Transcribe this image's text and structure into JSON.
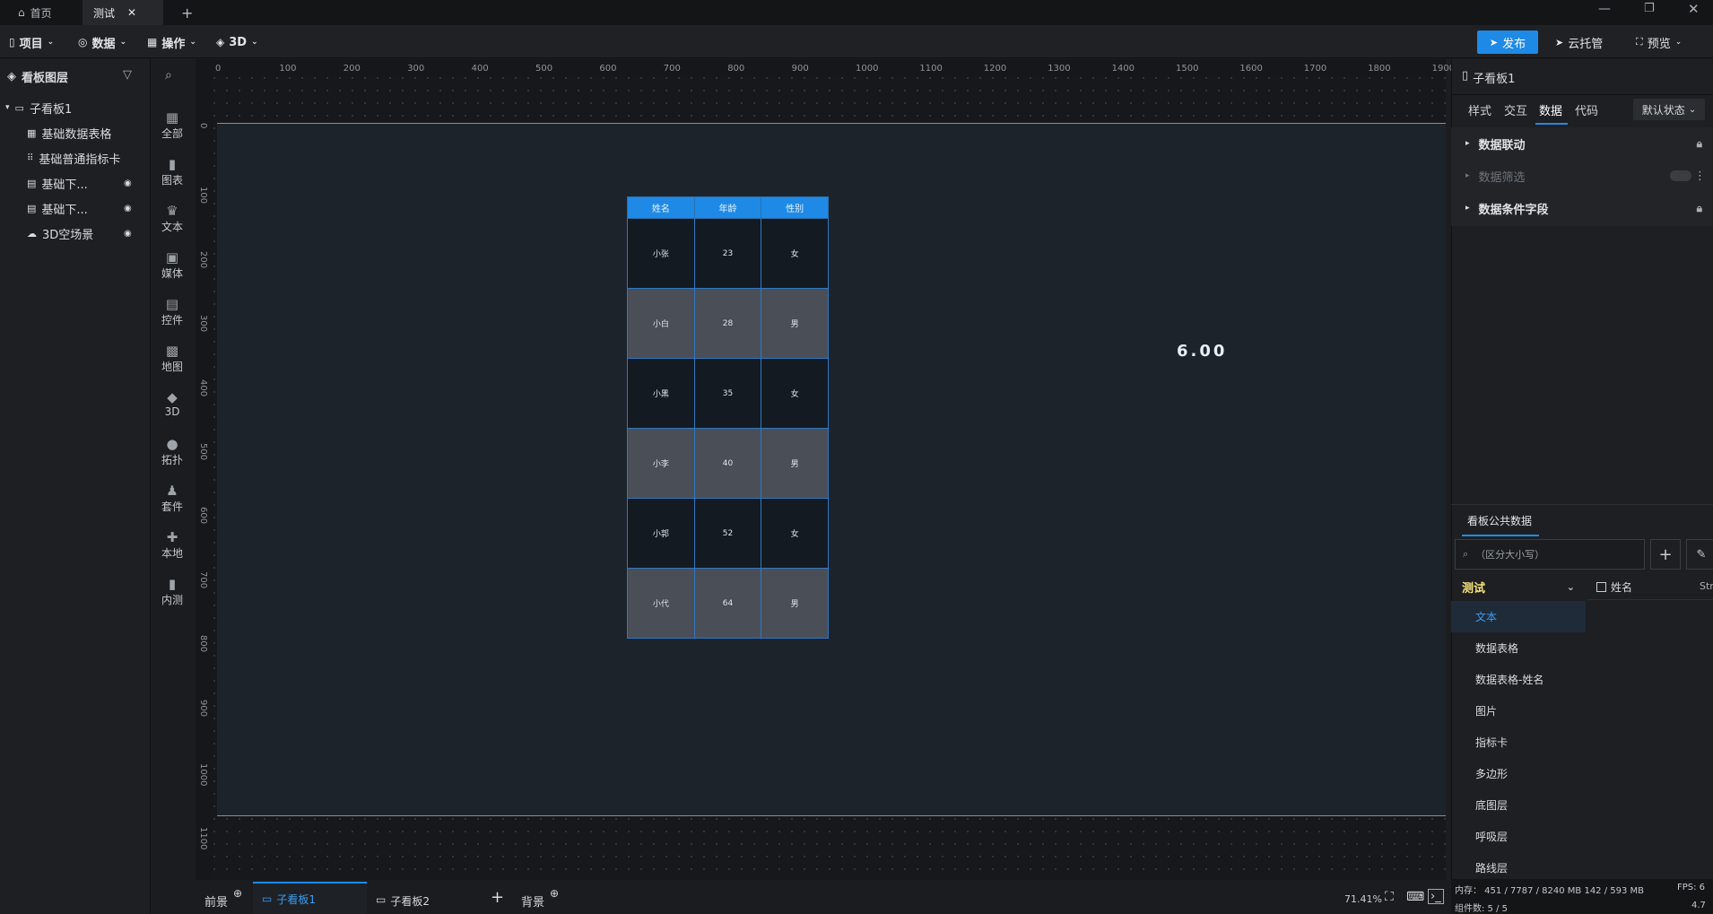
{
  "tabs": [
    {
      "label": "首页"
    },
    {
      "label": "测试"
    }
  ],
  "toolbar": {
    "project": "项目",
    "data": "数据",
    "operate": "操作",
    "three_d": "3D",
    "publish": "发布",
    "cloud": "云托管",
    "preview": "预览"
  },
  "layers_panel": {
    "title": "看板图层",
    "root": "子看板1",
    "items": [
      "基础数据表格",
      "基础普通指标卡",
      "基础下...",
      "基础下...",
      "3D空场景"
    ]
  },
  "component_bar": [
    "全部",
    "图表",
    "文本",
    "媒体",
    "控件",
    "地图",
    "3D",
    "拓扑",
    "套件",
    "本地",
    "内测"
  ],
  "ruler": {
    "h_ticks": [
      "0",
      "100",
      "200",
      "300",
      "400",
      "500",
      "600",
      "700",
      "800",
      "900",
      "1000",
      "1100",
      "1200",
      "1300",
      "1400",
      "1500",
      "1600",
      "1700",
      "1800",
      "1900"
    ],
    "v_ticks": [
      "0",
      "100",
      "200",
      "300",
      "400",
      "500",
      "600",
      "700",
      "800",
      "900",
      "1000",
      "1100"
    ]
  },
  "table": {
    "headers": [
      "姓名",
      "年龄",
      "性别"
    ],
    "rows": [
      [
        "小张",
        "23",
        "女"
      ],
      [
        "小白",
        "28",
        "男"
      ],
      [
        "小黑",
        "35",
        "女"
      ],
      [
        "小李",
        "40",
        "男"
      ],
      [
        "小郭",
        "52",
        "女"
      ],
      [
        "小代",
        "64",
        "男"
      ]
    ]
  },
  "metric_value": "6.00",
  "bottom": {
    "foreground": "前景",
    "board1": "子看板1",
    "board2": "子看板2",
    "background": "背景",
    "zoom": "71.41%"
  },
  "right_panel": {
    "title": "子看板1",
    "tabs": [
      "样式",
      "交互",
      "数据",
      "代码"
    ],
    "state": "默认状态",
    "sections": [
      "数据联动",
      "数据筛选",
      "数据条件字段"
    ],
    "public_data_title": "看板公共数据",
    "search_placeholder": "（区分大小写）",
    "group": "测试",
    "field": "姓名",
    "field_type": "Str",
    "list": [
      "文本",
      "数据表格",
      "数据表格-姓名",
      "图片",
      "指标卡",
      "多边形",
      "底图层",
      "呼吸层",
      "路线层"
    ]
  },
  "status": {
    "memory": "内存： 451 / 7787 / 8240 MB  142 / 593 MB",
    "fps": "FPS: 6",
    "components": "组件数: 5 / 5",
    "version": "4.7"
  },
  "colors": {
    "accent": "#1f8ae6",
    "publish_bg": "#1f8ae6"
  }
}
